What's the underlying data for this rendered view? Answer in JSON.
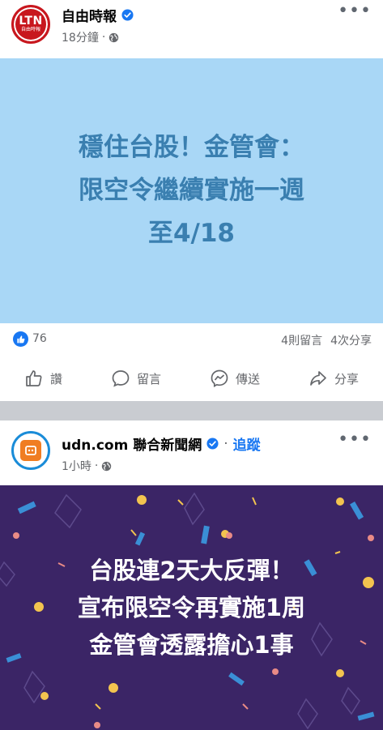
{
  "post1": {
    "page_name": "自由時報",
    "avatar_text": "LTN",
    "avatar_subtext": "自由時報",
    "time": "18分鐘",
    "banner_lines": [
      "穩住台股！金管會：",
      "限空令繼續實施一週",
      "至4/18"
    ],
    "banner_bg": "#a9d7f6",
    "banner_text_color": "#3a7fb0",
    "likes": "76",
    "comments": "4則留言",
    "shares": "4次分享"
  },
  "actions": {
    "like": "讚",
    "comment": "留言",
    "send": "傳送",
    "share": "分享"
  },
  "post2": {
    "page_name": "udn.com 聯合新聞網",
    "follow": "追蹤",
    "separator": "·",
    "time": "1小時",
    "banner_lines": [
      "台股連2天大反彈！",
      "宣布限空令再實施1周",
      "金管會透露擔心1事"
    ],
    "banner_bg": "#3b2566"
  },
  "ui": {
    "meta_dot": "·",
    "more": "•••",
    "accent": "#1877f2"
  }
}
